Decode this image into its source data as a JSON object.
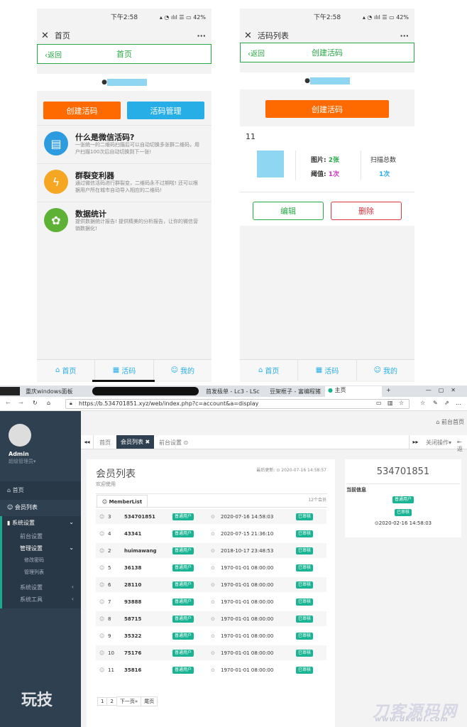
{
  "phone1": {
    "status_time": "下午2:58",
    "status_battery": "42",
    "wx_title": "首页",
    "back": "返回",
    "nav_title": "首页",
    "btn_create": "创建活码",
    "btn_manage": "活码管理",
    "features": [
      {
        "title": "什么是微信活码?",
        "desc": "一张统一的二维码扫描后可以自动切换多张群二维码，用户扫描100次后自动切换到下一张!",
        "color": "#2d9be0",
        "icon": "clipboard-icon"
      },
      {
        "title": "群裂变利器",
        "desc": "通过微信活码进行群裂变，二维码永不过期啦! 还可以根据用户所在城市自动导入相应的二维码!",
        "color": "#f5a623",
        "icon": "bolt-icon"
      },
      {
        "title": "数据统计",
        "desc": "提供数据统计报告! 提供精美的分析报告，让你的微信营销数据化!",
        "color": "#5db236",
        "icon": "gear-icon"
      }
    ],
    "tabs": [
      "首页",
      "活码",
      "我的"
    ]
  },
  "phone2": {
    "status_time": "下午2:58",
    "status_battery": "42",
    "wx_title": "活码列表",
    "back": "返回",
    "nav_title": "创建活码",
    "btn_create": "创建活码",
    "item_name": "11",
    "pic_label": "图片:",
    "pic_value": "2张",
    "threshold_label": "阈值:",
    "threshold_value": "1次",
    "scan_label": "扫描总数",
    "scan_value": "1次",
    "btn_edit": "编辑",
    "btn_delete": "删除",
    "tabs": [
      "首页",
      "活码",
      "我的"
    ]
  },
  "browser": {
    "url": "https://b.534701851.xyz/web/index.php?c=account&a=display",
    "tab_labels": [
      "重庆windows面板",
      "首发极单 - Lc3 - LSc",
      "豆架框子 - 富编程猪",
      "主页"
    ],
    "admin_name": "Admin",
    "admin_role": "超级管理员",
    "menu": {
      "home": "首页",
      "members": "会员列表",
      "system": "系统设置",
      "frontend": "前台设置",
      "manage": "管理设置",
      "change_pwd": "修改密码",
      "admin_list": "管理列表",
      "sys_settings": "系统设置",
      "sys_tools": "系统工具"
    },
    "top_right": "前台首页",
    "page_tabs": [
      "首页",
      "会员列表",
      "前台设置"
    ],
    "close_ops": "关闭操作",
    "back_label": "返",
    "list_title": "会员列表",
    "welcome": "欢迎使用",
    "last_update": "最后更新: ⊙ 2020-07-16 14:58:57",
    "member_tab": "MemberList",
    "member_count": "12个会员",
    "members": [
      {
        "id": "3",
        "name": "534701851",
        "role": "普通用户",
        "time": "2020-07-16 14:58:03",
        "status": "已审核"
      },
      {
        "id": "4",
        "name": "43341",
        "role": "普通用户",
        "time": "2020-07-15 21:36:10",
        "status": "已审核"
      },
      {
        "id": "2",
        "name": "huimawang",
        "role": "普通用户",
        "time": "2018-10-17 23:48:53",
        "status": "已审核"
      },
      {
        "id": "5",
        "name": "36138",
        "role": "普通用户",
        "time": "1970-01-01 08:00:00",
        "status": "已审核"
      },
      {
        "id": "6",
        "name": "28110",
        "role": "普通用户",
        "time": "1970-01-01 08:00:00",
        "status": "已审核"
      },
      {
        "id": "7",
        "name": "93888",
        "role": "普通用户",
        "time": "1970-01-01 08:00:00",
        "status": "已审核"
      },
      {
        "id": "8",
        "name": "58715",
        "role": "普通用户",
        "time": "1970-01-01 08:00:00",
        "status": "已审核"
      },
      {
        "id": "9",
        "name": "35322",
        "role": "普通用户",
        "time": "1970-01-01 08:00:00",
        "status": "已审核"
      },
      {
        "id": "10",
        "name": "75176",
        "role": "普通用户",
        "time": "1970-01-01 08:00:00",
        "status": "已审核"
      },
      {
        "id": "11",
        "name": "35816",
        "role": "普通用户",
        "time": "1970-01-01 08:00:00",
        "status": "已审核"
      }
    ],
    "pager": [
      "1",
      "2",
      "下一页»",
      "尾页"
    ],
    "detail_title": "534701851",
    "detail_label": "当前信息",
    "detail_role": "普通用户",
    "detail_status": "已审核",
    "detail_time": "⊙2020-02-16 14:58:03"
  },
  "watermark_left": "玩技",
  "watermark_right": "刀客源码网",
  "watermark_url": "www.dkewl.com"
}
